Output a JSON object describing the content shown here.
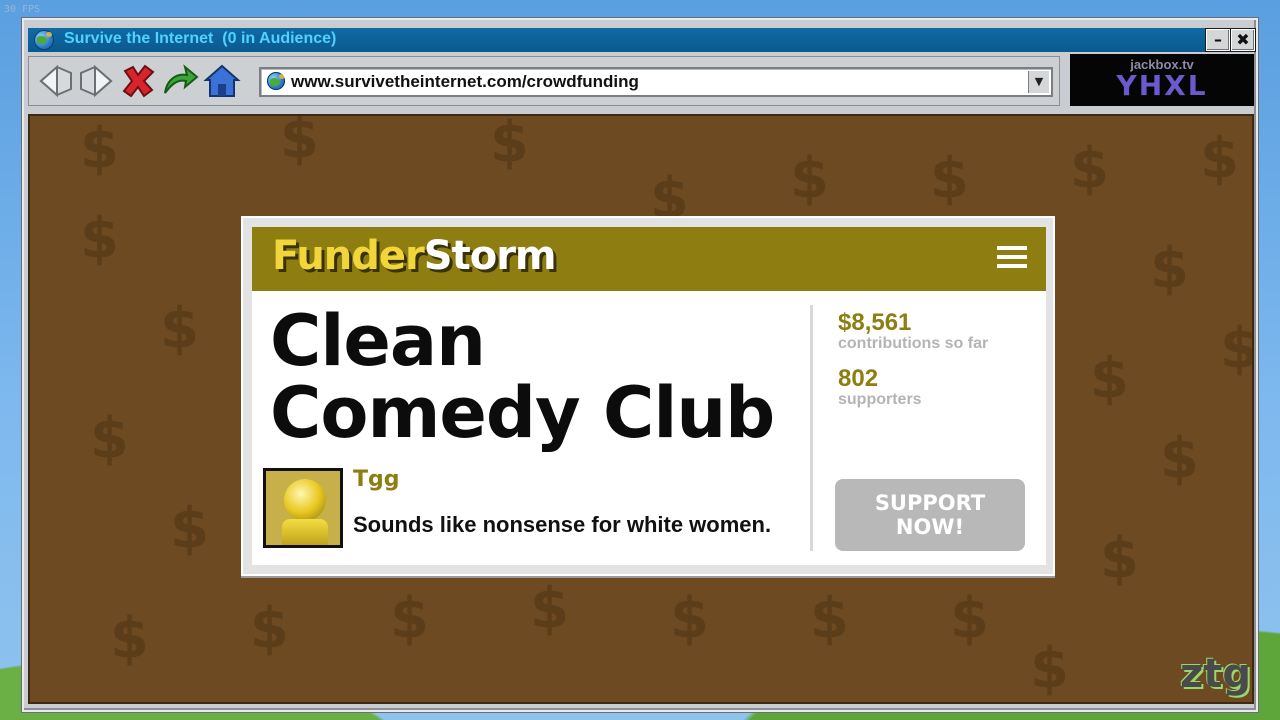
{
  "overlay": {
    "fps": "30 FPS"
  },
  "window": {
    "title": "Survive the Internet  (0 in Audience)",
    "minimize_label": "–",
    "close_label": "✖"
  },
  "toolbar": {
    "buttons": [
      "back-icon",
      "forward-icon",
      "stop-icon",
      "refresh-icon",
      "home-icon"
    ],
    "address": "www.survivetheinternet.com/crowdfunding",
    "dropdown_glyph": "▼"
  },
  "room": {
    "site": "jackbox.tv",
    "code": "YHXL"
  },
  "card": {
    "brand_part1": "Funder",
    "brand_part2": "Storm",
    "title_line1": "Clean",
    "title_line2": "Comedy Club",
    "commenter": "Tgg",
    "comment": "Sounds like nonsense for white women.",
    "contributions_value": "$8,561",
    "contributions_label": "contributions so far",
    "supporters_value": "802",
    "supporters_label": "supporters",
    "support_line1": "SUPPORT",
    "support_line2": "NOW!"
  },
  "colors": {
    "brand_bar": "#8e7e12",
    "brand_yellow": "#f0d63a",
    "background_brown": "#6e4a22",
    "titlebar": "#0a5a8e"
  },
  "watermark": {
    "text": "ztg"
  }
}
